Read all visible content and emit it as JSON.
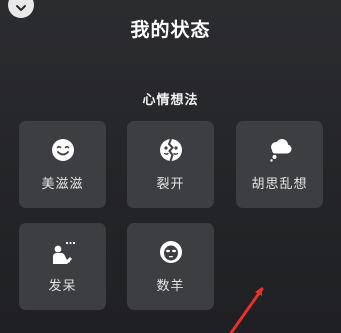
{
  "header": {
    "title": "我的状态",
    "collapse_icon": "chevron-down-icon"
  },
  "section": {
    "title": "心情想法"
  },
  "statuses": [
    {
      "label": "美滋滋",
      "icon": "smile-icon"
    },
    {
      "label": "裂开",
      "icon": "cracked-face-icon"
    },
    {
      "label": "胡思乱想",
      "icon": "thought-cloud-icon"
    },
    {
      "label": "发呆",
      "icon": "daydream-icon"
    },
    {
      "label": "数羊",
      "icon": "sheep-icon"
    }
  ],
  "colors": {
    "background": "#252629",
    "tile": "#3d3e42",
    "icon": "#ffffff",
    "annotation_arrow": "#e8312a"
  }
}
